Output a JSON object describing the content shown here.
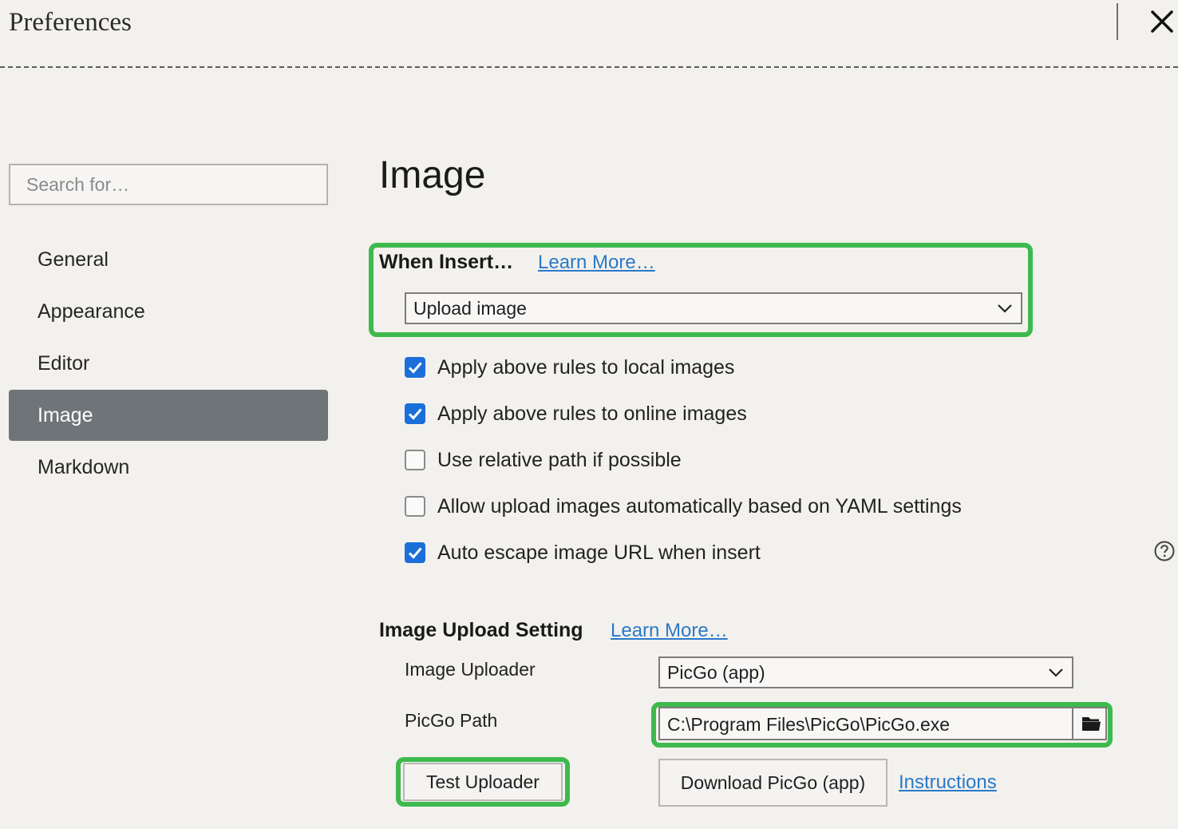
{
  "window": {
    "title": "Preferences"
  },
  "sidebar": {
    "search_placeholder": "Search for…",
    "items": [
      {
        "label": "General"
      },
      {
        "label": "Appearance"
      },
      {
        "label": "Editor"
      },
      {
        "label": "Image",
        "active": true
      },
      {
        "label": "Markdown"
      }
    ]
  },
  "main": {
    "title": "Image",
    "when_insert": {
      "label": "When Insert…",
      "learn_more": "Learn More…",
      "select_value": "Upload image"
    },
    "checkboxes": [
      {
        "label": "Apply above rules to local images",
        "checked": true
      },
      {
        "label": "Apply above rules to online images",
        "checked": true
      },
      {
        "label": "Use relative path if possible",
        "checked": false
      },
      {
        "label": "Allow upload images automatically based on YAML settings",
        "checked": false
      },
      {
        "label": "Auto escape image URL when insert",
        "checked": true
      }
    ],
    "upload_setting": {
      "label": "Image Upload Setting",
      "learn_more": "Learn More…",
      "uploader_label": "Image Uploader",
      "uploader_value": "PicGo (app)",
      "path_label": "PicGo Path",
      "path_value": "C:\\Program Files\\PicGo\\PicGo.exe",
      "test_button": "Test Uploader",
      "download_button": "Download PicGo (app)",
      "instructions_link": "Instructions"
    }
  },
  "colors": {
    "background": "#f3f1ed",
    "active_nav": "#6f7479",
    "checkbox_checked": "#1b6fd9",
    "link": "#2a79c9",
    "highlight": "#3dba4e"
  }
}
